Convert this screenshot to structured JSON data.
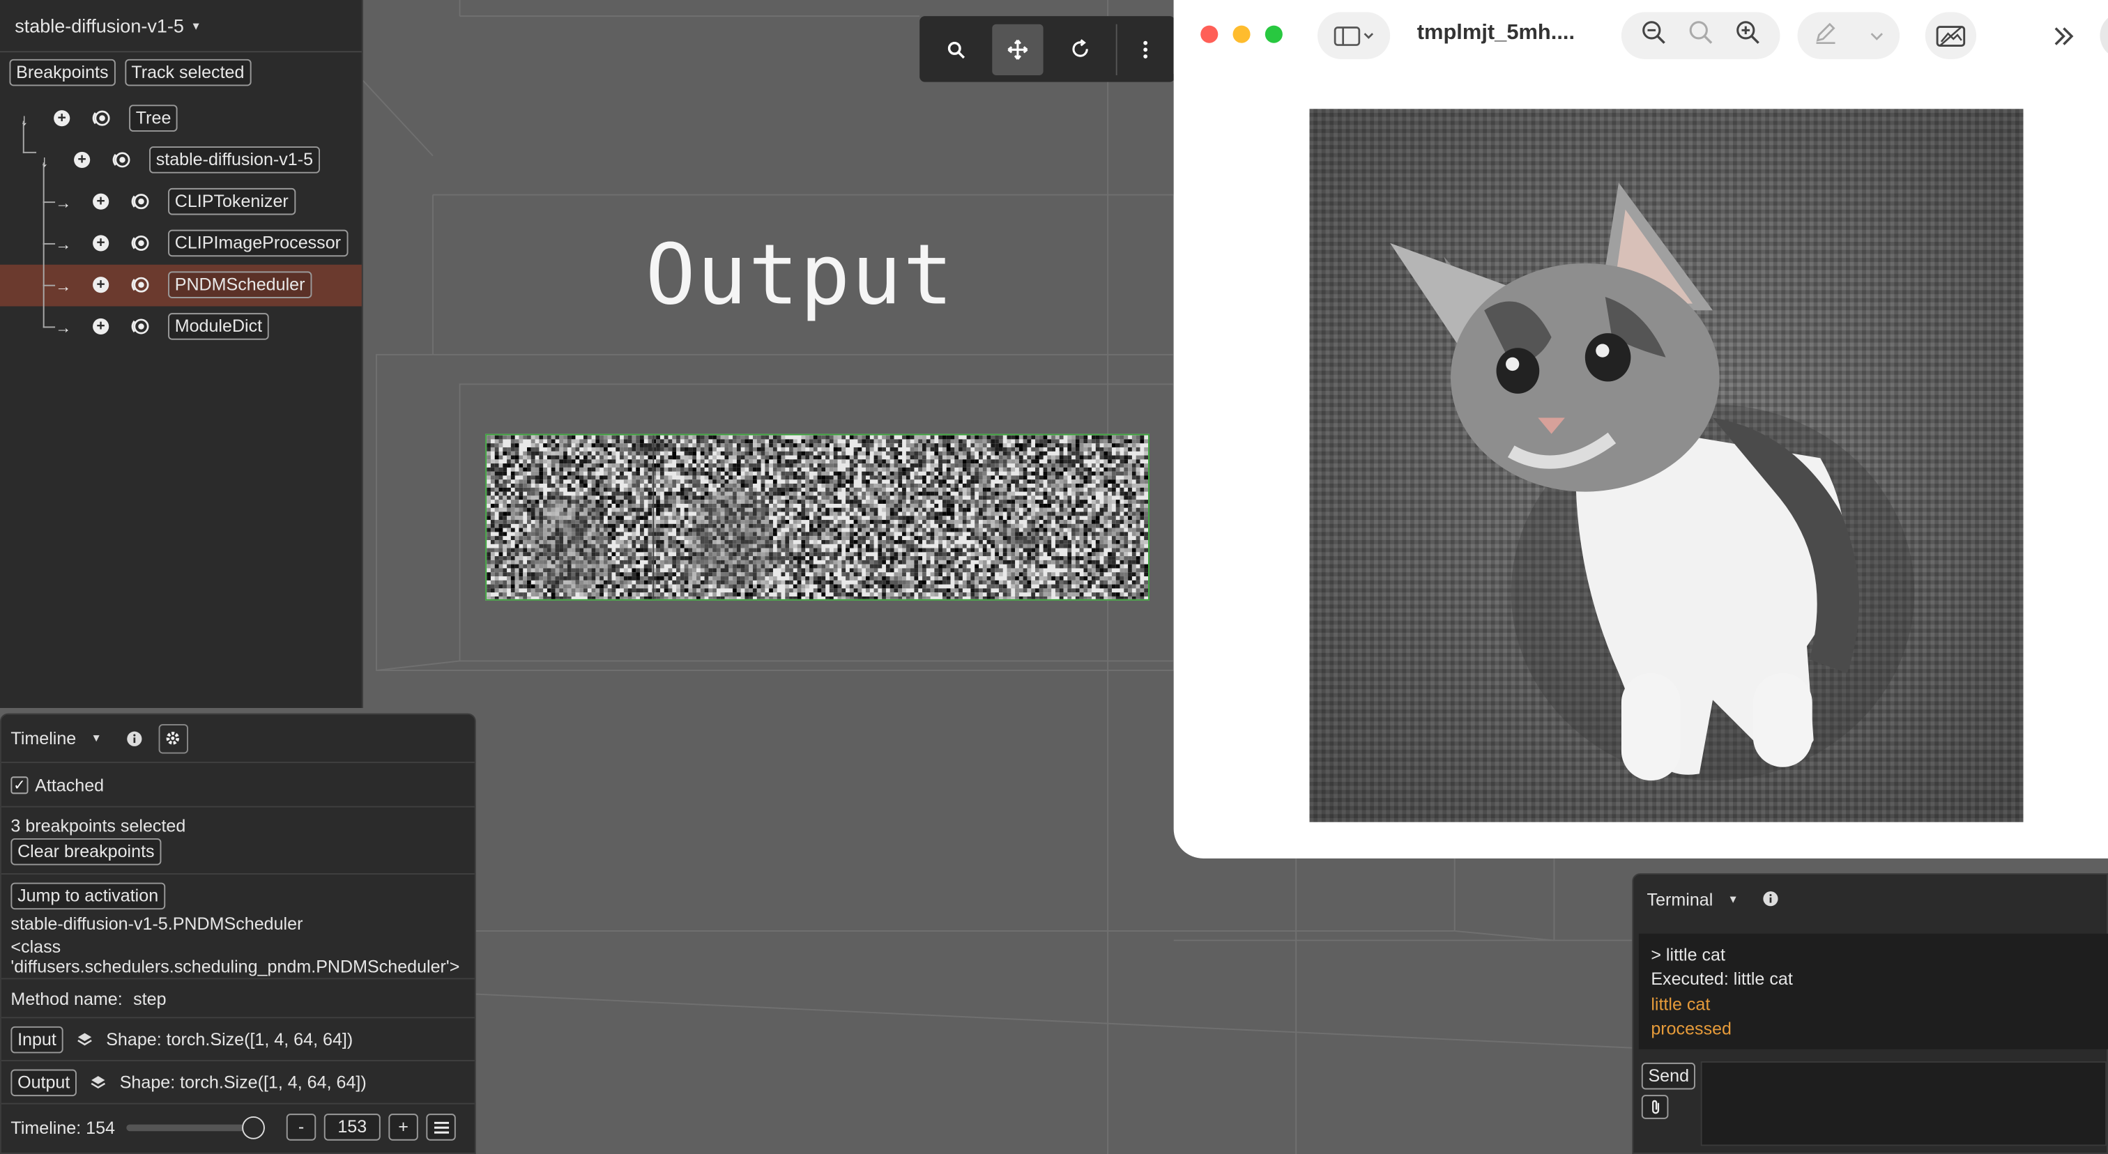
{
  "scene": {
    "output_title": "Output"
  },
  "toolbar": {
    "icons": [
      "search-icon",
      "move-icon",
      "rotate-icon",
      "more-vertical-icon"
    ],
    "active": "move-icon"
  },
  "left_panel": {
    "model_select": "stable-diffusion-v1-5",
    "breakpoints_label": "Breakpoints",
    "track_selected_label": "Track selected",
    "tree": [
      {
        "label": "Tree",
        "expanded": true
      },
      {
        "label": "stable-diffusion-v1-5",
        "expanded": true
      },
      {
        "label": "CLIPTokenizer"
      },
      {
        "label": "CLIPImageProcessor"
      },
      {
        "label": "PNDMScheduler",
        "selected": true
      },
      {
        "label": "ModuleDict"
      }
    ],
    "selected_color": "#6b3a2e"
  },
  "timeline": {
    "title": "Timeline",
    "attached_label": "Attached",
    "attached_checked": true,
    "breakpoints_selected": "3 breakpoints selected",
    "clear_breakpoints": "Clear breakpoints",
    "jump_to_activation": "Jump to activation",
    "module_path": "stable-diffusion-v1-5.PNDMScheduler",
    "class_text": "<class 'diffusers.schedulers.scheduling_pndm.PNDMScheduler'>",
    "method_label": "Method name:",
    "method_value": "step",
    "input_label": "Input",
    "input_shape": "Shape: torch.Size([1, 4, 64, 64])",
    "output_label": "Output",
    "output_shape": "Shape: torch.Size([1, 4, 64, 64])",
    "timeline_label": "Timeline: 154",
    "slider_position": 1.0,
    "minus": "-",
    "step_value": "153",
    "plus": "+"
  },
  "preview_window": {
    "title": "tmplmjt_5mh....",
    "traffic_lights": [
      "#ff5f57",
      "#febc2e",
      "#28c840"
    ],
    "image_subject": "kitten on grey fabric"
  },
  "terminal": {
    "title": "Terminal",
    "lines": [
      {
        "text": "> little cat",
        "color": "#e6e6e6"
      },
      {
        "text": "Executed: little cat",
        "color": "#e6e6e6"
      },
      {
        "text": "little cat",
        "color": "#e69b3a"
      },
      {
        "text": "processed",
        "color": "#e69b3a"
      }
    ],
    "send_label": "Send"
  }
}
